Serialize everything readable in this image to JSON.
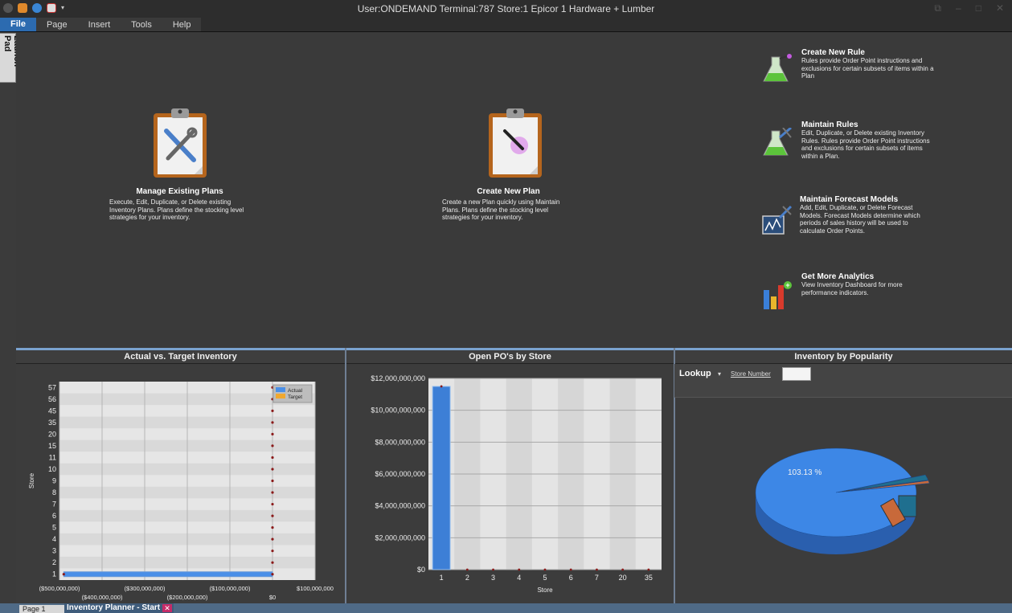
{
  "window": {
    "title": "User:ONDEMAND Terminal:787 Store:1 Epicor 1 Hardware + Lumber"
  },
  "menu": {
    "items": [
      "File",
      "Page",
      "Insert",
      "Tools",
      "Help"
    ]
  },
  "launch_pad": {
    "label": "Launch Pad"
  },
  "tiles": {
    "manage_plans": {
      "title": "Manage Existing Plans",
      "desc": "Execute, Edit, Duplicate, or Delete existing Inventory Plans.  Plans define the stocking level strategies for your inventory."
    },
    "create_plan": {
      "title": "Create New Plan",
      "desc": "Create a new Plan quickly using Maintain Plans. Plans define the stocking level strategies for your inventory."
    },
    "create_rule": {
      "title": "Create New Rule",
      "desc": "Rules provide Order Point instructions and exclusions for certain subsets of items within a Plan"
    },
    "maintain_rules": {
      "title": "Maintain Rules",
      "desc": "Edit, Duplicate, or Delete existing Inventory Rules. Rules provide Order Point instructions and exclusions for certain subsets of items within a Plan."
    },
    "maintain_forecast": {
      "title": "Maintain Forecast Models",
      "desc": "Add, Edit, Duplicate, or Delete Forecast Models.  Forecast Models determine which periods of sales history will be used to calculate Order Points."
    },
    "analytics": {
      "title": "Get More Analytics",
      "desc": "View Inventory Dashboard for more performance indicators."
    }
  },
  "panels": {
    "actual_target": {
      "title": "Actual vs. Target Inventory"
    },
    "open_pos": {
      "title": "Open PO's by Store"
    },
    "popularity": {
      "title": "Inventory by Popularity",
      "lookup_label": "Lookup",
      "lookup_arrow": "▾",
      "store_number_label": "Store Number",
      "store_number_value": ""
    }
  },
  "tabs": {
    "page_tab": "Page 1",
    "doc_tab": "Inventory Planner - Start",
    "close_glyph": "✕"
  },
  "chart_data": [
    {
      "type": "bar",
      "orientation": "horizontal",
      "title": "Actual vs. Target Inventory",
      "ylabel": "Store",
      "categories": [
        "1",
        "2",
        "3",
        "4",
        "5",
        "6",
        "7",
        "8",
        "9",
        "10",
        "11",
        "15",
        "20",
        "35",
        "45",
        "56",
        "57"
      ],
      "xlim": [
        -500000000,
        100000000
      ],
      "x_ticks_row1": [
        "($500,000,000)",
        "($300,000,000)",
        "($100,000,000)",
        "$100,000,000"
      ],
      "x_ticks_row2": [
        "($400,000,000)",
        "($200,000,000)",
        "$0"
      ],
      "series": [
        {
          "name": "Actual",
          "color": "#4a8fe8",
          "values": [
            -490000000,
            0,
            0,
            0,
            0,
            0,
            0,
            0,
            0,
            0,
            0,
            0,
            0,
            0,
            0,
            0,
            0
          ]
        },
        {
          "name": "Target",
          "color": "#f0a830",
          "values": [
            0,
            0,
            0,
            0,
            0,
            0,
            0,
            0,
            0,
            0,
            0,
            0,
            0,
            0,
            0,
            0,
            0
          ]
        }
      ],
      "legend": "top-right",
      "grid": true
    },
    {
      "type": "bar",
      "title": "Open PO's by Store",
      "xlabel": "Store",
      "categories": [
        "1",
        "2",
        "3",
        "4",
        "5",
        "6",
        "7",
        "20",
        "35"
      ],
      "values": [
        11500000000,
        0,
        0,
        0,
        0,
        0,
        0,
        0,
        0
      ],
      "ylim": [
        0,
        12000000000
      ],
      "y_ticks": [
        "$0",
        "$2,000,000,000",
        "$4,000,000,000",
        "$6,000,000,000",
        "$8,000,000,000",
        "$10,000,000,000",
        "$12,000,000,000"
      ],
      "color": "#3d7fd6",
      "grid": true
    },
    {
      "type": "pie",
      "title": "Inventory by Popularity",
      "slices": [
        {
          "label": "103.13 %",
          "value": 103.13,
          "color": "#3d87e6"
        },
        {
          "label": "",
          "value": 2.0,
          "color": "#1f6f8f"
        },
        {
          "label": "",
          "value": 1.0,
          "color": "#c8693a"
        }
      ]
    }
  ]
}
